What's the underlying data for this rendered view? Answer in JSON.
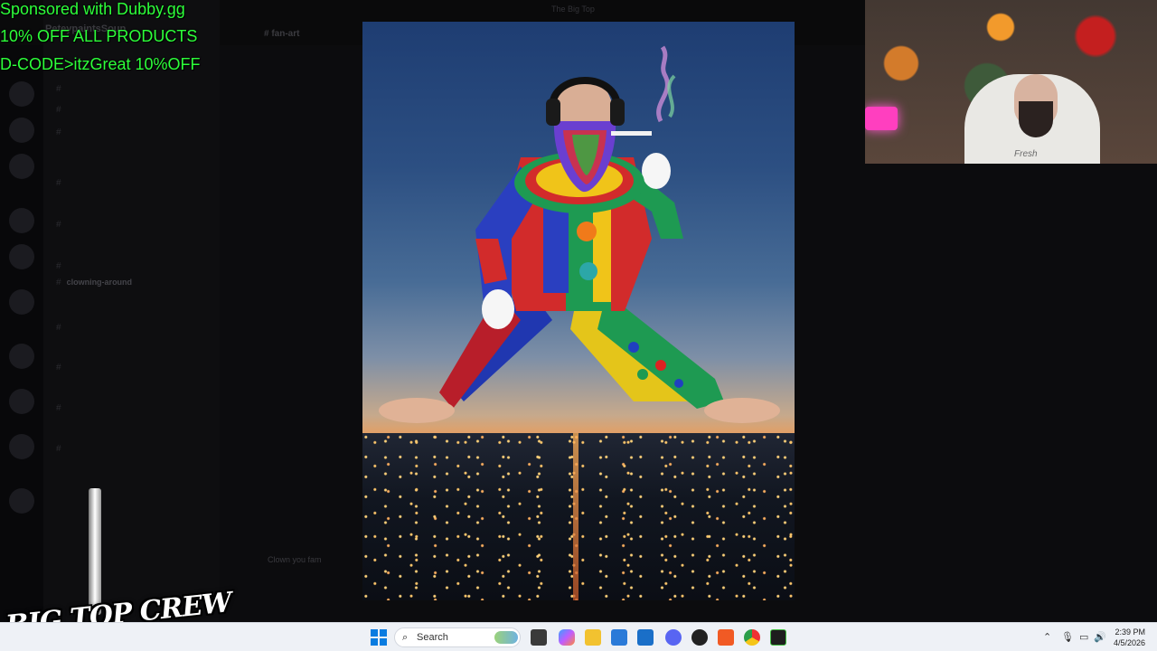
{
  "sponsor": {
    "line1": "Sponsored with Dubby.gg",
    "line2": "10% OFF ALL PRODUCTS",
    "line3": "D-CODE>itzGreat 10%OFF"
  },
  "discord": {
    "window_title": "The Big Top",
    "server_name": "PeteypaintsSoup",
    "channel_title": "# fan-art",
    "active_channel": "clowning-around",
    "chat_input_text": "Clown you fam"
  },
  "logo": {
    "text": "BIG TOP CREW"
  },
  "webcam": {
    "shirt_text": "Fresh"
  },
  "taskbar": {
    "search_placeholder": "Search",
    "search_glyph": "⌕",
    "pinned_apps": [
      "start-icon",
      "file-explorer-icon",
      "copilot-icon",
      "folder-icon",
      "store-icon",
      "outlook-icon",
      "discord-icon",
      "obs-icon",
      "brave-icon",
      "chrome-icon",
      "terminal-icon"
    ],
    "tray_chevron": "⌃",
    "tray_mic": "🎙",
    "tray_net": "▭",
    "tray_vol": "🔊",
    "clock_time": "2:39 PM",
    "clock_date": "4/5/2026"
  },
  "colors": {
    "sponsor_green": "#2dff3a",
    "taskbar_bg": "#eef1f6",
    "webcam_light": "#ff3fbf"
  }
}
